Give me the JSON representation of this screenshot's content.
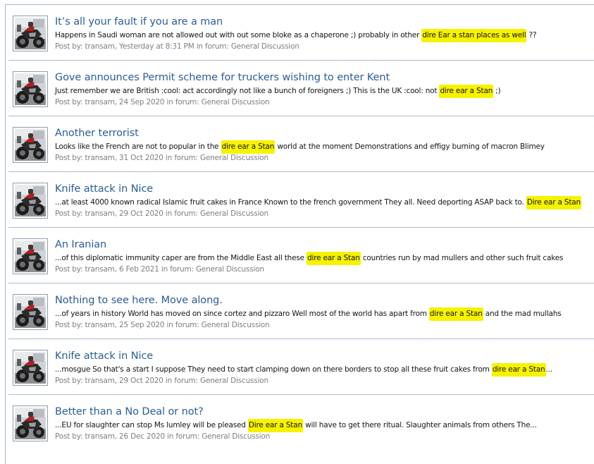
{
  "labels": {
    "posted_by": "Post by:",
    "in_forum": "in forum:"
  },
  "colors": {
    "title_link": "#2a5d93",
    "highlight": "#f6f200",
    "meta_text": "#7a7f85",
    "divider": "#a9bdd0"
  },
  "results": [
    {
      "title": "It’s all your fault if you are a man",
      "snippet_before": "Happens in Saudi woman are not allowed out with out some bloke as a chaperone ;) probably in other ",
      "snippet_highlight": "dire Ear a stan places as well",
      "snippet_after": " ??",
      "author": "transam",
      "date": "Yesterday at 8:31 PM",
      "forum": "General Discussion",
      "avatar_icon": "motorcycle-avatar-icon"
    },
    {
      "title": "Gove announces Permit scheme for truckers wishing to enter Kent",
      "snippet_before": "Just remember we are British :cool: act accordingly not like a bunch of foreigners ;) This is the UK :cool: not ",
      "snippet_highlight": "dire ear a Stan",
      "snippet_after": " ;)",
      "author": "transam",
      "date": "24 Sep 2020",
      "forum": "General Discussion",
      "avatar_icon": "motorcycle-avatar-icon"
    },
    {
      "title": "Another terrorist",
      "snippet_before": "Looks like the French are not to popular in the ",
      "snippet_highlight": "dire ear a Stan",
      "snippet_after": " world at the moment Demonstrations and effigy burning of macron Blimey",
      "author": "transam",
      "date": "31 Oct 2020",
      "forum": "General Discussion",
      "avatar_icon": "motorcycle-avatar-icon"
    },
    {
      "title": "Knife attack in Nice",
      "snippet_before": "...at least 4000 known radical Islamic fruit cakes in France Known to the french government They all. Need deporting ASAP back to. ",
      "snippet_highlight": "Dire ear a Stan",
      "snippet_after": "",
      "author": "transam",
      "date": "29 Oct 2020",
      "forum": "General Discussion",
      "avatar_icon": "motorcycle-avatar-icon"
    },
    {
      "title": "An Iranian",
      "snippet_before": "...of this diplomatic immunity caper are from the Middle East all these ",
      "snippet_highlight": "dire ear a Stan",
      "snippet_after": " countries run by mad mullers and other such fruit cakes",
      "author": "transam",
      "date": "6 Feb 2021",
      "forum": "General Discussion",
      "avatar_icon": "motorcycle-avatar-icon"
    },
    {
      "title": "Nothing to see here. Move along.",
      "snippet_before": "...of years in history World has moved on since cortez and pizzaro Well most of the world has apart from ",
      "snippet_highlight": "dire ear a Stan",
      "snippet_after": " and the mad mullahs",
      "author": "transam",
      "date": "25 Sep 2020",
      "forum": "General Discussion",
      "avatar_icon": "motorcycle-avatar-icon"
    },
    {
      "title": "Knife attack in Nice",
      "snippet_before": "...mosgue So that's a start I suppose They need to start clamping down on there borders to stop all these fruit cakes from ",
      "snippet_highlight": "dire ear a Stan",
      "snippet_after": "...",
      "author": "transam",
      "date": "29 Oct 2020",
      "forum": "General Discussion",
      "avatar_icon": "motorcycle-avatar-icon"
    },
    {
      "title": "Better than a No Deal or not?",
      "snippet_before": "...EU for slaughter can stop Ms lumley will be pleased ",
      "snippet_highlight": "Dire ear a Stan",
      "snippet_after": " will have to get there ritual. Slaughter animals from others The...",
      "author": "transam",
      "date": "26 Dec 2020",
      "forum": "General Discussion",
      "avatar_icon": "motorcycle-avatar-icon"
    }
  ]
}
